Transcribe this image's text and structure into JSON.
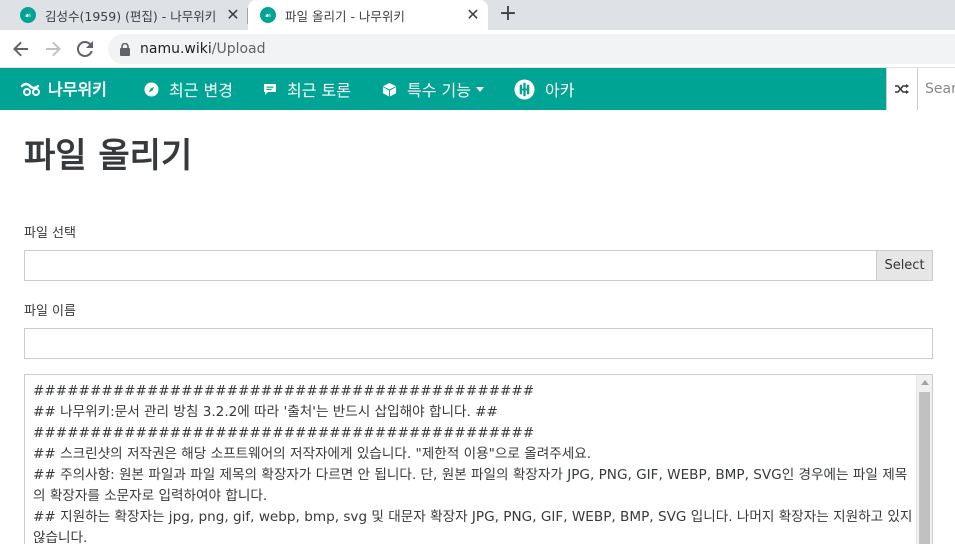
{
  "browser": {
    "tabs": [
      {
        "title": "김성수(1959) (편집) - 나무위키",
        "active": false
      },
      {
        "title": "파일 올리기 - 나무위키",
        "active": true
      }
    ],
    "close_glyph": "✕",
    "new_tab_glyph": "+",
    "url_host": "namu.wiki",
    "url_path": "/Upload"
  },
  "navbar": {
    "brand": "나무위키",
    "items": [
      {
        "label": "최근 변경",
        "icon": "compass-icon"
      },
      {
        "label": "최근 토론",
        "icon": "comment-icon"
      },
      {
        "label": "특수 기능",
        "icon": "cube-icon",
        "dropdown": true
      },
      {
        "label": "아카",
        "icon": "arca-icon"
      }
    ],
    "search_placeholder": "Search",
    "color": "#00a495"
  },
  "page": {
    "title": "파일 올리기",
    "file_select_label": "파일 선택",
    "select_button": "Select",
    "file_name_label": "파일 이름",
    "file_name_value": "",
    "textarea_lines": [
      "############################################",
      "## 나무위키:문서 관리 방침 3.2.2에 따라 '출처'는 반드시 삽입해야 합니다. ##",
      "############################################",
      "## 스크린샷의 저작권은 해당 소프트웨어의 저작자에게 있습니다. \"제한적 이용\"으로 올려주세요.",
      "## 주의사항: 원본 파일과 파일 제목의 확장자가 다르면 안 됩니다. 단, 원본 파일의 확장자가 JPG, PNG, GIF, WEBP, BMP, SVG인 경우에는 파일 제목의 확장자를 소문자로 입력하여야 합니다.",
      "## 지원하는 확장자는 jpg, png, gif, webp, bmp, svg 및 대문자 확장자 JPG, PNG, GIF, WEBP, BMP, SVG 입니다. 나머지 확장자는 지원하고 있지 않습니다."
    ]
  }
}
